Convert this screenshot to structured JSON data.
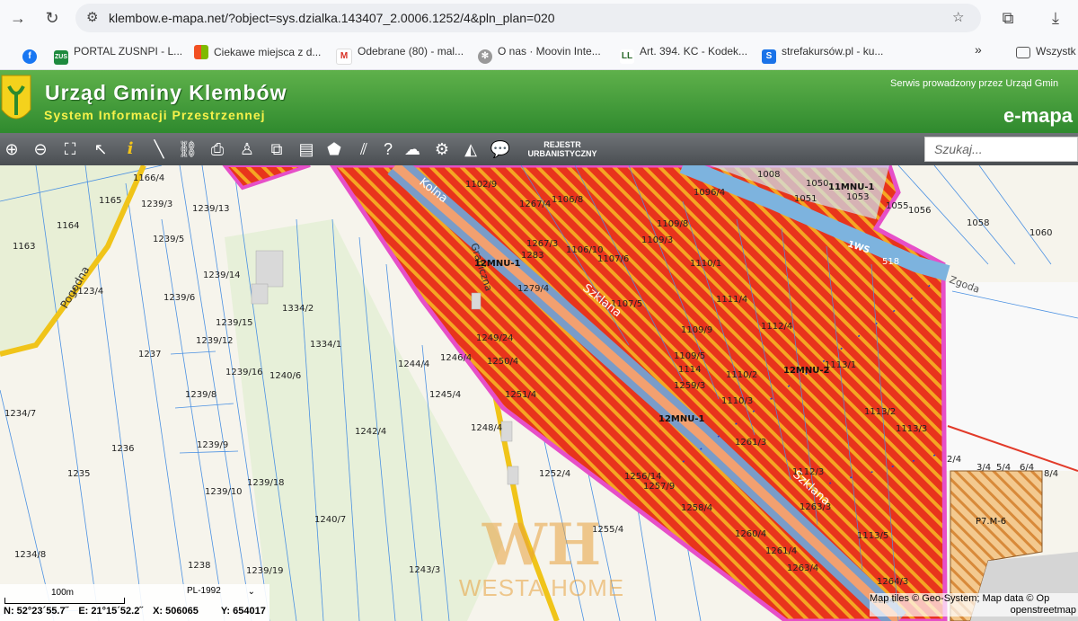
{
  "browser": {
    "url": "klembow.e-mapa.net/?object=sys.dzialka.143407_2.0006.1252/4&pln_plan=020",
    "bookmarks": [
      {
        "label": "",
        "icon": "facebook-icon"
      },
      {
        "label": "PORTAL ZUSNPI - L...",
        "icon": "zus-icon"
      },
      {
        "label": "Ciekawe miejsca z d...",
        "icon": "windows-icon"
      },
      {
        "label": "Odebrane (80) - mal...",
        "icon": "gmail-icon"
      },
      {
        "label": "O nas · Moovin Inte...",
        "icon": "moovin-icon"
      },
      {
        "label": "Art. 394. KC - Kodek...",
        "icon": "lexlege-icon"
      },
      {
        "label": "strefakursów.pl - ku...",
        "icon": "strefa-icon"
      }
    ],
    "overflow": "»",
    "all_bookmarks": "Wszystk"
  },
  "site": {
    "title": "Urząd Gminy Klembów",
    "subtitle": "System Informacji Przestrzennej",
    "service": "Serwis prowadzony przez Urząd Gmin",
    "brand": "e-mapa"
  },
  "toolbar": {
    "rejestr_line1": "REJESTR",
    "rejestr_line2": "URBANISTYCZNY",
    "search_placeholder": "Szukaj..."
  },
  "map": {
    "parcels": [
      "1166/4",
      "1165",
      "1239/3",
      "1239/13",
      "1164",
      "1239/5",
      "1163",
      "1239/14",
      "1123/4",
      "1239/6",
      "1334/2",
      "1239/15",
      "1239/12",
      "1334/1",
      "1237",
      "1239/16",
      "1240/6",
      "1244/4",
      "1246/4",
      "1250/4",
      "1249/24",
      "1239/8",
      "1245/4",
      "1251/4",
      "1234/7",
      "1242/4",
      "1248/4",
      "1239/9",
      "1236",
      "1235",
      "1239/18",
      "1252/4",
      "1256/14",
      "1257/9",
      "1239/10",
      "1255/4",
      "1258/4",
      "1240/7",
      "1234/8",
      "1238",
      "1239/19",
      "1243/3",
      "1102/9",
      "1267/4",
      "1106/8",
      "1096/4",
      "1008",
      "1050",
      "1051",
      "1053",
      "1055",
      "1056",
      "1058",
      "1060",
      "1109/8",
      "1267/3",
      "1106/10",
      "1109/3",
      "1283",
      "1107/6",
      "1110/1",
      "1279/4",
      "1107/5",
      "1111/4",
      "1109/9",
      "1112/4",
      "1109/5",
      "1114",
      "1110/2",
      "1113/1",
      "1259/3",
      "1110/3",
      "1113/2",
      "1113/3",
      "1261/3",
      "1112/3",
      "1263/3",
      "2/4",
      "3/4",
      "5/4",
      "6/4",
      "8/4",
      "1260/4",
      "1261/4",
      "1263/4",
      "1113/5",
      "1264/3",
      "1264"
    ],
    "roads": [
      "Kolna",
      "Szklana",
      "Szklana",
      "Graniczna",
      "Pogodna",
      "Zgoda"
    ],
    "zones": [
      "12MNU-1",
      "12MNU-2",
      "12MNU-1",
      "1WS",
      "518",
      "11MNU-1",
      "P7.M-6"
    ],
    "watermark_logo": "WH",
    "watermark_text": "WESTA HOME",
    "scale_label": "100m",
    "crs": "PL-1992",
    "coords": {
      "n": "N: 52°23´55.7˝",
      "e": "E: 21°15´52.2˝",
      "x": "X: 506065",
      "y": "Y: 654017"
    },
    "attribution_line1": "Map tiles © Geo-System; Map data © Op",
    "attribution_line2": "openstreetmap"
  },
  "colors": {
    "header_green": "#3d9a36",
    "zone_red": "#e8341c",
    "zone_orange": "#f5a623",
    "boundary_magenta": "#e64fc8",
    "road_blue": "#7a9cc8",
    "parcel_line": "#4a90e2"
  }
}
